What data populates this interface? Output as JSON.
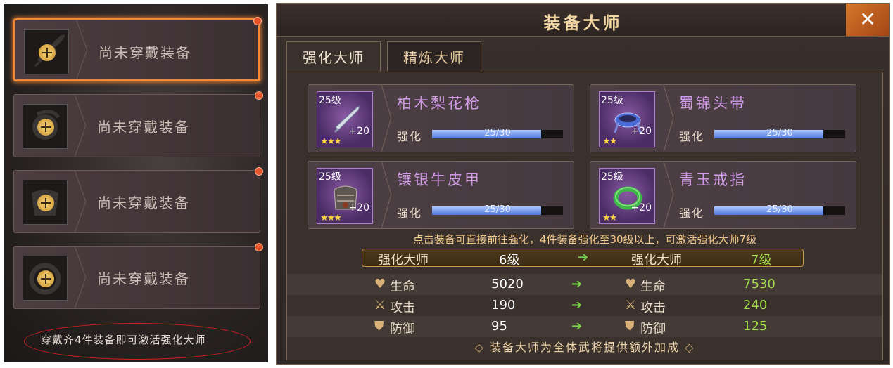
{
  "left_panel": {
    "slots": [
      {
        "label": "尚未穿戴装备",
        "selected": true
      },
      {
        "label": "尚未穿戴装备",
        "selected": false
      },
      {
        "label": "尚未穿戴装备",
        "selected": false
      },
      {
        "label": "尚未穿戴装备",
        "selected": false
      }
    ],
    "hint": "穿戴齐4件装备即可激活强化大师"
  },
  "right_panel": {
    "title": "装备大师",
    "close_glyph": "✕",
    "tabs": [
      {
        "label": "强化大师",
        "active": true
      },
      {
        "label": "精炼大师",
        "active": false
      }
    ],
    "equipment": [
      {
        "name": "柏木梨花枪",
        "level": "25级",
        "bonus": "+20",
        "stars": 3,
        "strengthen_label": "强化",
        "progress": "25/30",
        "progress_fraction": 0.833,
        "icon": "spear-icon"
      },
      {
        "name": "蜀锦头带",
        "level": "25级",
        "bonus": "+20",
        "stars": 2,
        "strengthen_label": "强化",
        "progress": "25/30",
        "progress_fraction": 0.833,
        "icon": "headband-icon"
      },
      {
        "name": "镶银牛皮甲",
        "level": "25级",
        "bonus": "+20",
        "stars": 3,
        "strengthen_label": "强化",
        "progress": "25/30",
        "progress_fraction": 0.833,
        "icon": "armor-icon"
      },
      {
        "name": "青玉戒指",
        "level": "25级",
        "bonus": "+20",
        "stars": 2,
        "strengthen_label": "强化",
        "progress": "25/30",
        "progress_fraction": 0.833,
        "icon": "ring-icon"
      }
    ],
    "info": "点击装备可直接前往强化，4件装备强化至30级以上，可激活强化大师7级",
    "master": {
      "label_from": "强化大师",
      "level_from": "6级",
      "label_to": "强化大师",
      "level_to": "7级"
    },
    "stats": [
      {
        "name": "生命",
        "icon": "heart-icon",
        "from": "5020",
        "to": "7530"
      },
      {
        "name": "攻击",
        "icon": "sword-icon",
        "from": "190",
        "to": "240"
      },
      {
        "name": "防御",
        "icon": "shield-icon",
        "from": "95",
        "to": "125"
      }
    ],
    "footer": "装备大师为全体武将提供额外加成",
    "footer_ornament": "◇"
  },
  "colors": {
    "accent_orange": "#f08a3a",
    "name_purple": "#d29be8",
    "stat_green": "#a3dd4a",
    "gold": "#f2c98a"
  }
}
